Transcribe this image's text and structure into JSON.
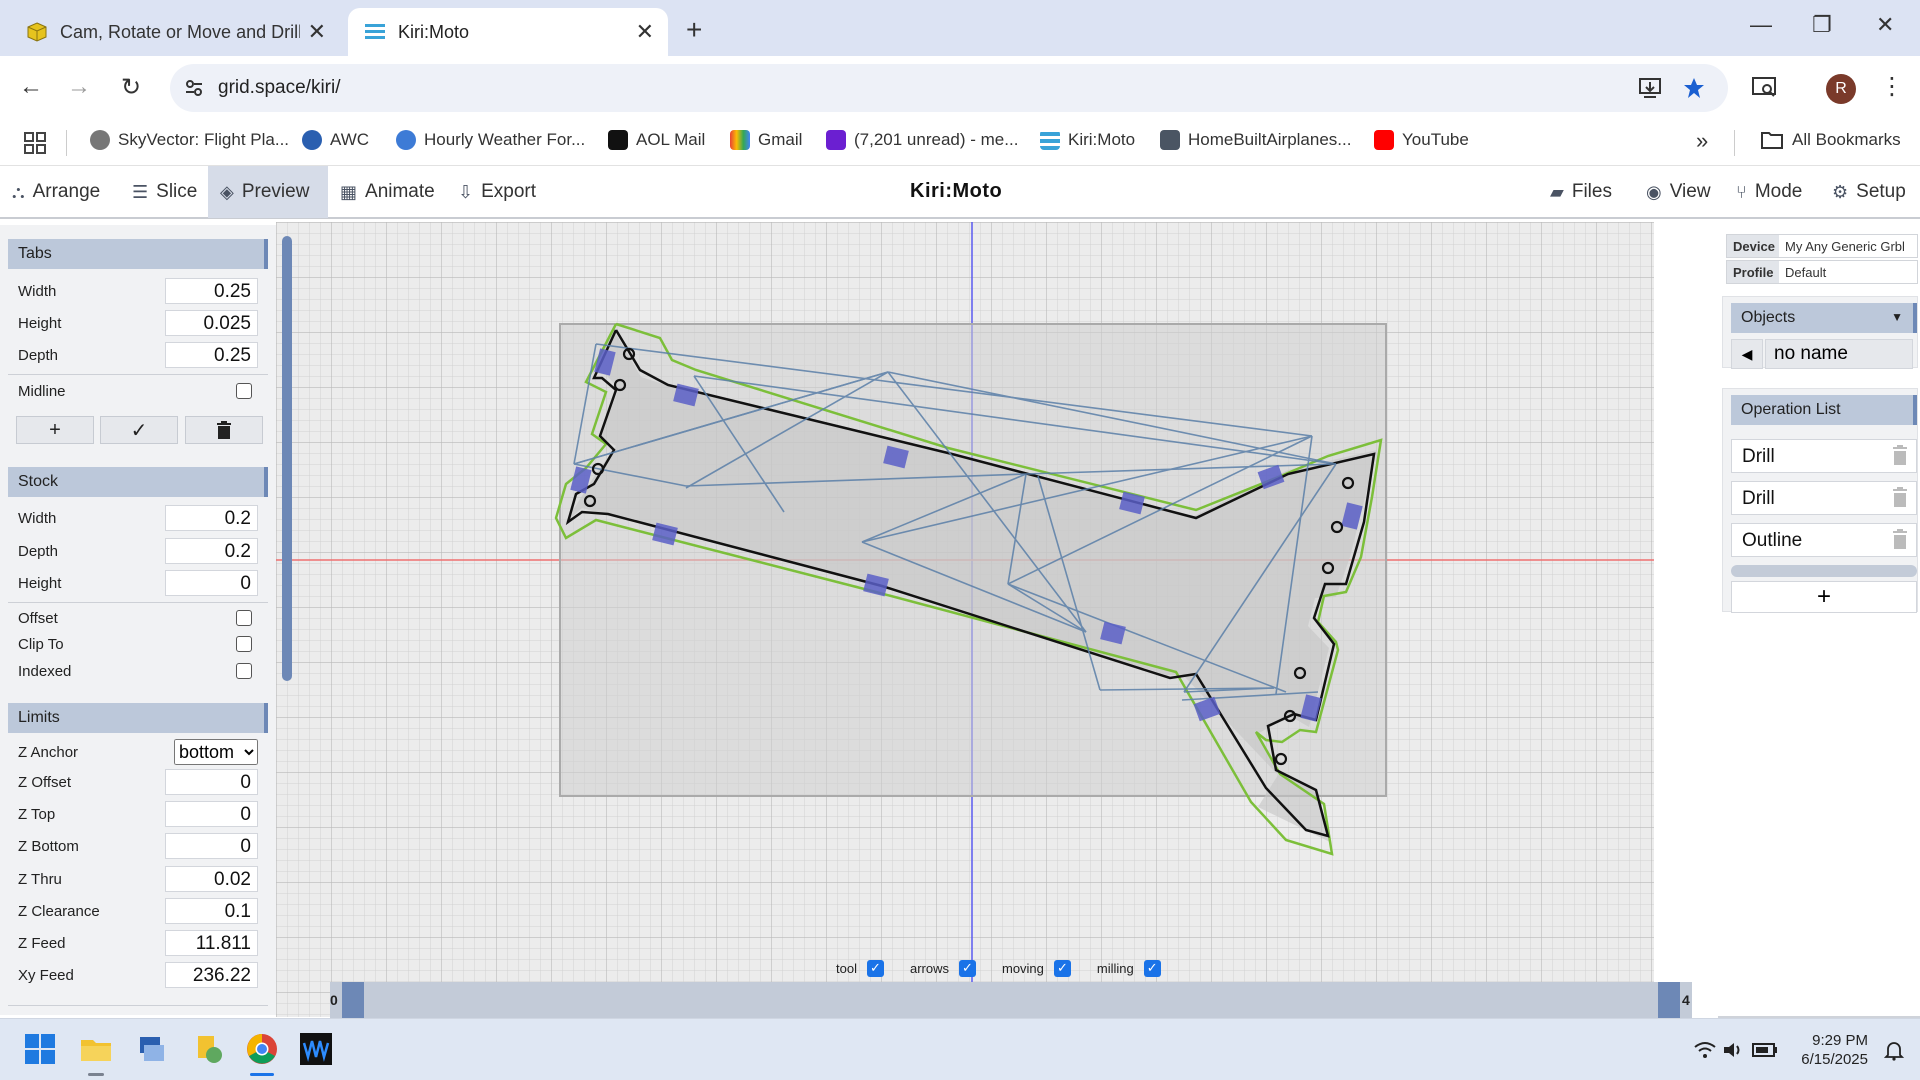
{
  "browser": {
    "tabs": [
      {
        "title": "Cam, Rotate or Move and Drilling",
        "active": false
      },
      {
        "title": "Kiri:Moto",
        "active": true
      }
    ],
    "url": "grid.space/kiri/",
    "profile_initial": "R",
    "bookmarks": [
      {
        "label": "SkyVector: Flight Pla...",
        "icon": "skyvector-icon"
      },
      {
        "label": "AWC",
        "icon": "awc-icon"
      },
      {
        "label": "Hourly Weather For...",
        "icon": "weather-icon"
      },
      {
        "label": "AOL Mail",
        "icon": "aol-icon"
      },
      {
        "label": "Gmail",
        "icon": "gmail-icon"
      },
      {
        "label": "(7,201 unread) - me...",
        "icon": "yahoo-mail-icon"
      },
      {
        "label": "Kiri:Moto",
        "icon": "kirimoto-icon"
      },
      {
        "label": "HomeBuiltAirplanes...",
        "icon": "homebuilt-icon"
      },
      {
        "label": "YouTube",
        "icon": "youtube-icon"
      }
    ],
    "all_bookmarks": "All Bookmarks"
  },
  "app": {
    "brand": "Kiri:Moto",
    "menu_left": [
      {
        "label": "Arrange",
        "icon": "arrange-icon"
      },
      {
        "label": "Slice",
        "icon": "slice-icon"
      },
      {
        "label": "Preview",
        "icon": "preview-icon",
        "active": true
      },
      {
        "label": "Animate",
        "icon": "animate-icon"
      },
      {
        "label": "Export",
        "icon": "export-icon"
      }
    ],
    "menu_right": [
      {
        "label": "Files",
        "icon": "folder-icon"
      },
      {
        "label": "View",
        "icon": "eye-icon"
      },
      {
        "label": "Mode",
        "icon": "mode-icon"
      },
      {
        "label": "Setup",
        "icon": "gear-icon"
      }
    ]
  },
  "left": {
    "tabs": {
      "title": "Tabs",
      "width_label": "Width",
      "width": "0.25",
      "height_label": "Height",
      "height": "0.025",
      "depth_label": "Depth",
      "depth": "0.25",
      "midline_label": "Midline"
    },
    "stock": {
      "title": "Stock",
      "width_label": "Width",
      "width": "0.2",
      "depth_label": "Depth",
      "depth": "0.2",
      "height_label": "Height",
      "height": "0",
      "offset_label": "Offset",
      "clipto_label": "Clip To",
      "indexed_label": "Indexed"
    },
    "limits": {
      "title": "Limits",
      "zanchor_label": "Z Anchor",
      "zanchor": "bottom",
      "zoffset_label": "Z Offset",
      "zoffset": "0",
      "ztop_label": "Z Top",
      "ztop": "0",
      "zbottom_label": "Z Bottom",
      "zbottom": "0",
      "zthru_label": "Z Thru",
      "zthru": "0.02",
      "zclear_label": "Z Clearance",
      "zclear": "0.1",
      "zfeed_label": "Z Feed",
      "zfeed": "11.811",
      "xyfeed_label": "Xy Feed",
      "xyfeed": "236.22"
    }
  },
  "right": {
    "device_label": "Device",
    "device": "My Any Generic Grbl",
    "profile_label": "Profile",
    "profile": "Default",
    "objects_title": "Objects",
    "object_name": "no name",
    "oplist_title": "Operation List",
    "operations": [
      "Drill",
      "Drill",
      "Outline"
    ],
    "add_label": "+"
  },
  "view_toggles": [
    {
      "label": "tool",
      "checked": true
    },
    {
      "label": "arrows",
      "checked": true
    },
    {
      "label": "moving",
      "checked": true
    },
    {
      "label": "milling",
      "checked": true
    }
  ],
  "layer_slider": {
    "min": "0",
    "max": "4"
  },
  "taskbar": {
    "time": "9:29 PM",
    "date": "6/15/2025"
  },
  "colors": {
    "accent": "#6d88b6",
    "section_header": "#bcc8da",
    "toolpath": "#5a7fa8",
    "outline_green": "#7cbf3a",
    "tab_marker": "#5b5fc7"
  }
}
